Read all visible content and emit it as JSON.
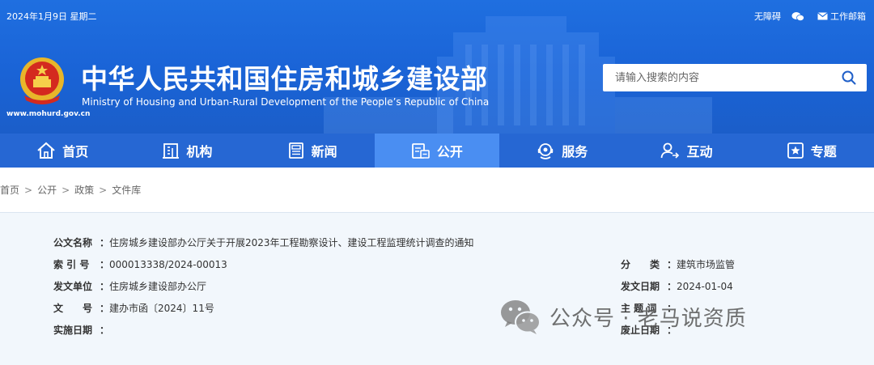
{
  "topbar": {
    "date": "2024年1月9日 星期二",
    "accessibility": "无障碍",
    "mailbox": "工作邮箱"
  },
  "site": {
    "url": "www.mohurd.gov.cn",
    "title_cn": "中华人民共和国住房和城乡建设部",
    "title_en": "Ministry of Housing and Urban-Rural Development of the People’s Republic of China"
  },
  "search": {
    "placeholder": "请输入搜索的内容",
    "value": ""
  },
  "nav": [
    {
      "label": "首页",
      "icon": "home-icon"
    },
    {
      "label": "机构",
      "icon": "building-icon"
    },
    {
      "label": "新闻",
      "icon": "news-icon"
    },
    {
      "label": "公开",
      "icon": "open-icon",
      "active": true
    },
    {
      "label": "服务",
      "icon": "service-icon"
    },
    {
      "label": "互动",
      "icon": "interact-icon"
    },
    {
      "label": "专题",
      "icon": "special-icon"
    }
  ],
  "breadcrumb": [
    "首页",
    "公开",
    "政策",
    "文件库"
  ],
  "doc": {
    "name_label": "公文名称",
    "name": "住房城乡建设部办公厅关于开展2023年工程勘察设计、建设工程监理统计调查的通知",
    "index_label": "索 引 号",
    "index": "000013338/2024-00013",
    "issuer_label": "发文单位",
    "issuer": "住房城乡建设部办公厅",
    "number_label": "文　　号",
    "number": "建办市函〔2024〕11号",
    "effective_label": "实施日期",
    "effective": "",
    "category_label": "分　　类",
    "category": "建筑市场监管",
    "date_label": "发文日期",
    "date": "2024-01-04",
    "subject_label": "主 题 词",
    "subject": "",
    "expiry_label": "废止日期",
    "expiry": ""
  },
  "watermark": {
    "text": "公众号 · 老马说资质",
    "icon": "wechat-icon"
  },
  "colors": {
    "header_blue": "#1f6fe0",
    "nav_blue": "#2667d3",
    "nav_active": "#4a8ef2",
    "panel_bg": "#f2f7fc"
  }
}
